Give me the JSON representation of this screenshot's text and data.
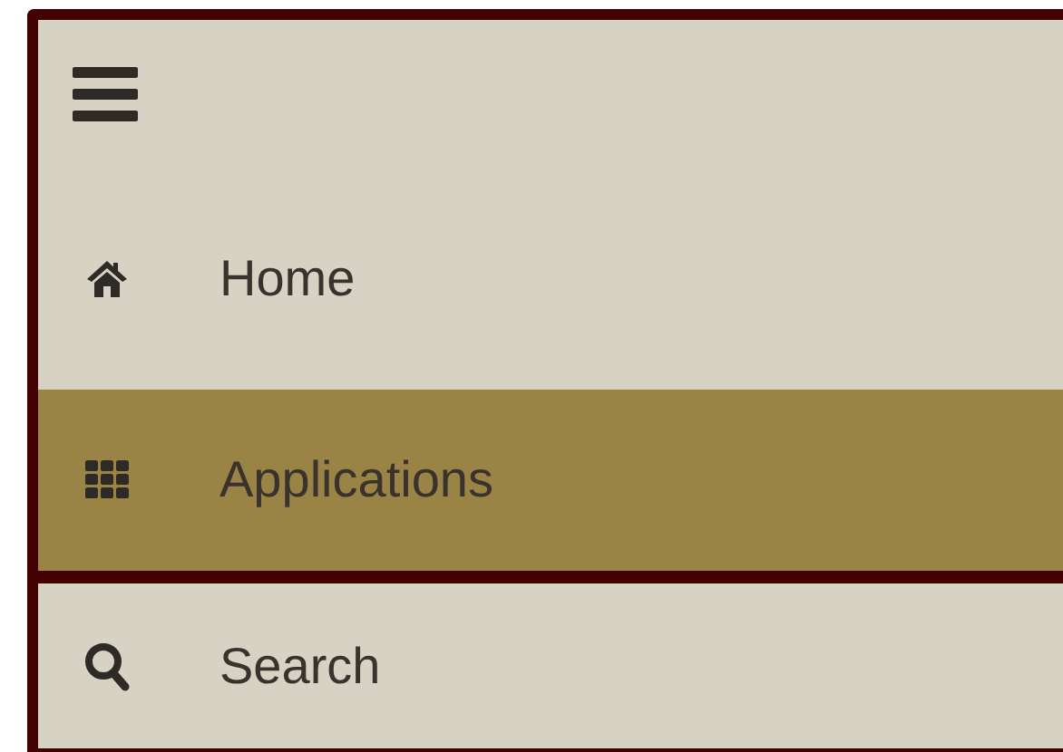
{
  "menu_button": {
    "kind": "hamburger"
  },
  "nav_items": [
    {
      "label": "Home",
      "kind": "home",
      "selected": false
    },
    {
      "label": "Applications",
      "kind": "grid",
      "selected": true
    },
    {
      "label": "Search",
      "kind": "search",
      "selected": false
    }
  ]
}
